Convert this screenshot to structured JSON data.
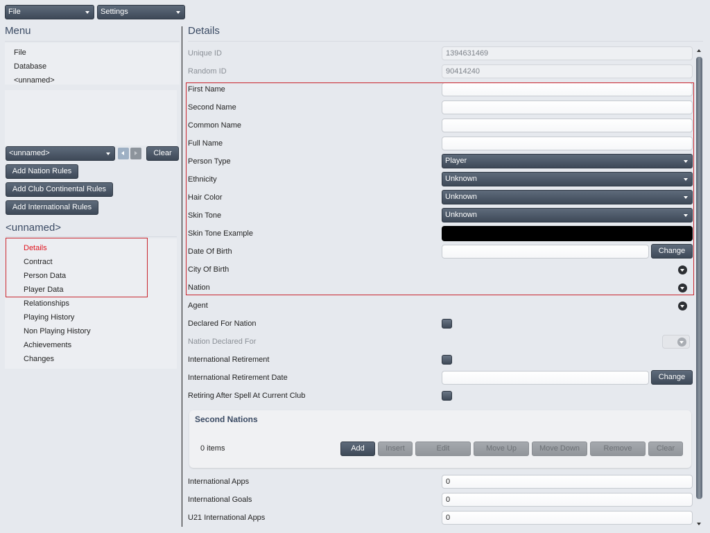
{
  "topbar": {
    "file_label": "File",
    "settings_label": "Settings"
  },
  "menu": {
    "title": "Menu",
    "items": [
      {
        "label": "File"
      },
      {
        "label": "Database"
      },
      {
        "label": "<unnamed>"
      }
    ]
  },
  "rules": {
    "selector_value": "<unnamed>",
    "clear_label": "Clear",
    "add_nation_rules": "Add Nation Rules",
    "add_club_continental_rules": "Add Club Continental Rules",
    "add_international_rules": "Add International Rules"
  },
  "record": {
    "title": "<unnamed>",
    "pages": [
      {
        "label": "Details",
        "active": true
      },
      {
        "label": "Contract"
      },
      {
        "label": "Person Data"
      },
      {
        "label": "Player Data"
      },
      {
        "label": "Relationships"
      },
      {
        "label": "Playing History"
      },
      {
        "label": "Non Playing History"
      },
      {
        "label": "Achievements"
      },
      {
        "label": "Changes"
      }
    ]
  },
  "details": {
    "title": "Details",
    "fields": {
      "unique_id": {
        "label": "Unique ID",
        "value": "1394631469"
      },
      "random_id": {
        "label": "Random ID",
        "value": "90414240"
      },
      "first_name": {
        "label": "First Name",
        "value": ""
      },
      "second_name": {
        "label": "Second Name",
        "value": ""
      },
      "common_name": {
        "label": "Common Name",
        "value": ""
      },
      "full_name": {
        "label": "Full Name",
        "value": ""
      },
      "person_type": {
        "label": "Person Type",
        "value": "Player"
      },
      "ethnicity": {
        "label": "Ethnicity",
        "value": "Unknown"
      },
      "hair_color": {
        "label": "Hair Color",
        "value": "Unknown"
      },
      "skin_tone": {
        "label": "Skin Tone",
        "value": "Unknown"
      },
      "skin_tone_example": {
        "label": "Skin Tone Example",
        "color": "#000000"
      },
      "date_of_birth": {
        "label": "Date Of Birth",
        "value": "",
        "button": "Change"
      },
      "city_of_birth": {
        "label": "City Of Birth"
      },
      "nation": {
        "label": "Nation"
      },
      "agent": {
        "label": "Agent"
      },
      "declared_for_nation": {
        "label": "Declared For Nation",
        "checked": false
      },
      "nation_declared_for": {
        "label": "Nation Declared For"
      },
      "international_retirement": {
        "label": "International Retirement",
        "checked": false
      },
      "international_retirement_date": {
        "label": "International Retirement Date",
        "value": "",
        "button": "Change"
      },
      "retiring_after_spell": {
        "label": "Retiring After Spell At Current Club",
        "checked": false
      },
      "international_apps": {
        "label": "International Apps",
        "value": "0"
      },
      "international_goals": {
        "label": "International Goals",
        "value": "0"
      },
      "u21_international_apps": {
        "label": "U21 International Apps",
        "value": "0"
      }
    },
    "second_nations": {
      "title": "Second Nations",
      "count": "0 items",
      "buttons": {
        "add": "Add",
        "insert": "Insert",
        "edit": "Edit",
        "move_up": "Move Up",
        "move_down": "Move Down",
        "remove": "Remove",
        "clear": "Clear"
      }
    }
  },
  "colors": {
    "highlight_border": "#c8242c",
    "active_item": "#e0141e",
    "heading": "#3a4a63"
  }
}
